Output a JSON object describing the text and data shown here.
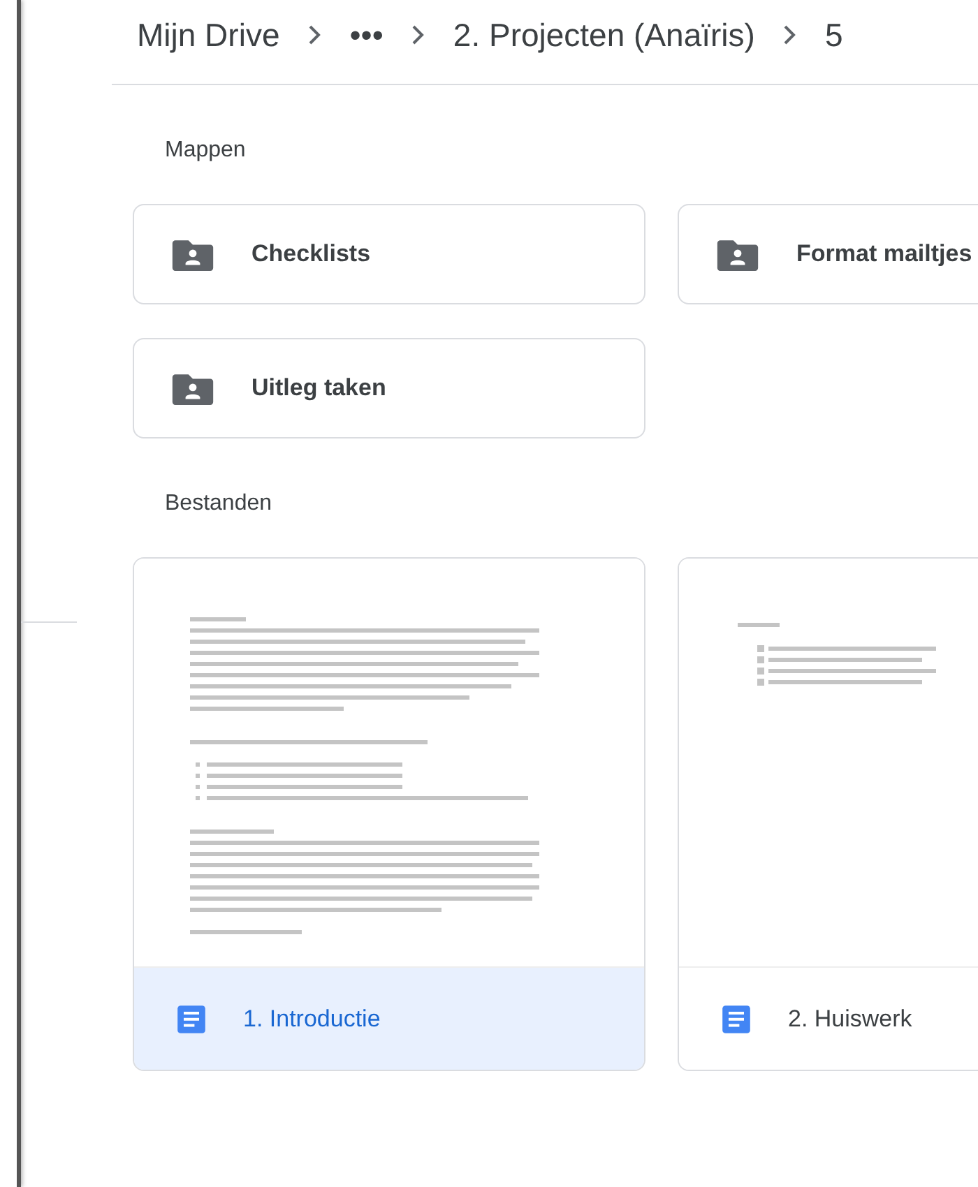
{
  "breadcrumb": [
    "Mijn Drive",
    "•••",
    "2. Projecten (Anaïris)",
    "5"
  ],
  "folders_heading": "Mappen",
  "folders": [
    {
      "name": "Checklists"
    },
    {
      "name": "Format mailtjes"
    },
    {
      "name": "Uitleg taken"
    }
  ],
  "files_heading": "Bestanden",
  "files": [
    {
      "name": "1. Introductie",
      "selected": true
    },
    {
      "name": "2. Huiswerk",
      "selected": false
    }
  ]
}
